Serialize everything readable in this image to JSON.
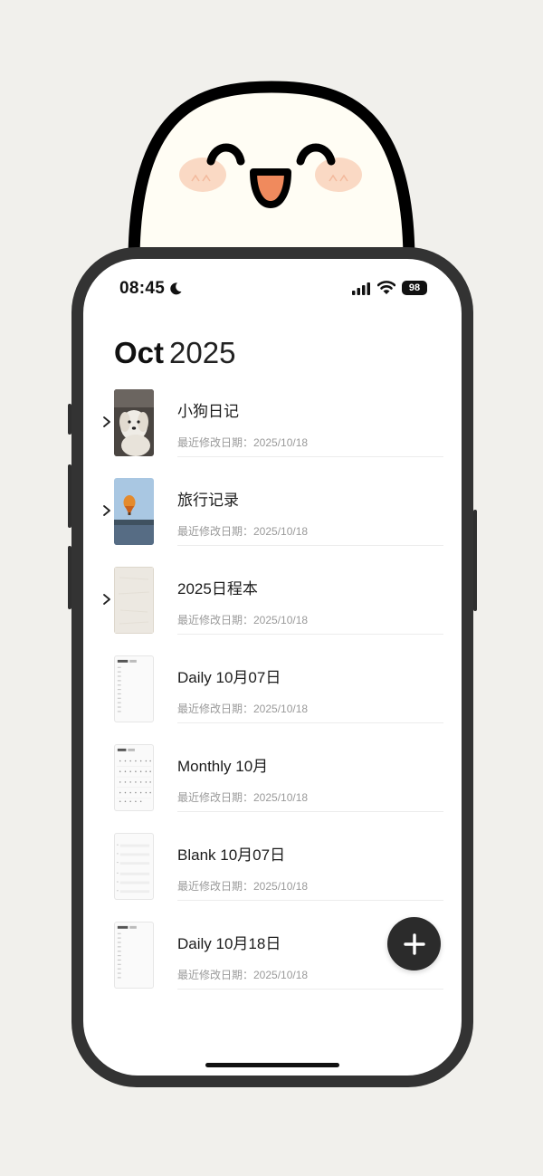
{
  "status_bar": {
    "time": "08:45",
    "battery": "98"
  },
  "header": {
    "month": "Oct",
    "year": "2025"
  },
  "notebooks": [
    {
      "title": "小狗日记",
      "modified": "最近修改日期：2025/10/18",
      "thumb": "dog-photo",
      "expandable": true
    },
    {
      "title": "旅行记录",
      "modified": "最近修改日期：2025/10/18",
      "thumb": "balloon-photo",
      "expandable": true
    },
    {
      "title": "2025日程本",
      "modified": "最近修改日期：2025/10/18",
      "thumb": "planner-cover",
      "expandable": true
    },
    {
      "title": "Daily 10月07日",
      "modified": "最近修改日期：2025/10/18",
      "thumb": "daily-page",
      "expandable": false
    },
    {
      "title": "Monthly 10月",
      "modified": "最近修改日期：2025/10/18",
      "thumb": "monthly-page",
      "expandable": false
    },
    {
      "title": "Blank 10月07日",
      "modified": "最近修改日期：2025/10/18",
      "thumb": "blank-page",
      "expandable": false
    },
    {
      "title": "Daily 10月18日",
      "modified": "最近修改日期：2025/10/18",
      "thumb": "daily-page",
      "expandable": false
    }
  ],
  "icons": {
    "fab": "plus-icon",
    "expand": "chevron-right-icon"
  },
  "colors": {
    "background": "#f1f0ec",
    "phone_frame": "#333333",
    "fab": "#2b2b2b",
    "mascot_face": "#fffdf4",
    "mascot_mouth": "#f08a5d",
    "mascot_cheek": "#fad9c4"
  }
}
